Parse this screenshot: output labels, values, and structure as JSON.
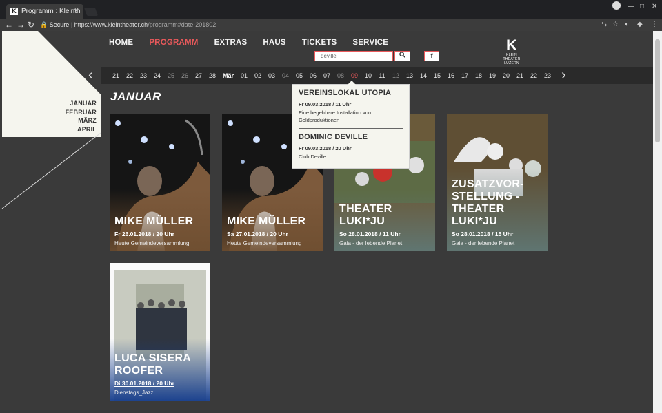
{
  "browser": {
    "tab_title": "Programm : Kleinth",
    "secure_label": "Secure",
    "url_host": "https://www.kleintheater.ch",
    "url_path": "/programm#date-201802"
  },
  "side": {
    "months": [
      "JANUAR",
      "FEBRUAR",
      "MÄRZ",
      "APRIL"
    ]
  },
  "nav": {
    "items": [
      {
        "label": "HOME"
      },
      {
        "label": "PROGRAMM"
      },
      {
        "label": "EXTRAS"
      },
      {
        "label": "HAUS"
      },
      {
        "label": "TICKETS"
      },
      {
        "label": "SERVICE"
      }
    ],
    "active_color": "#e8595b"
  },
  "search": {
    "value": "deville",
    "button_icon": "search-icon",
    "facebook_label": "f"
  },
  "logo": {
    "letter": "K",
    "line1": "KLEIN",
    "line2": "THEATER LUZERN"
  },
  "dates": {
    "feb_days": [
      "21",
      "22",
      "23",
      "24",
      "25",
      "26",
      "27",
      "28"
    ],
    "feb_dim": [
      "25",
      "26"
    ],
    "month_label": "Mär",
    "mar_days": [
      "01",
      "02",
      "03",
      "04",
      "05",
      "06",
      "07",
      "08",
      "09",
      "10",
      "11",
      "12",
      "13",
      "14",
      "15",
      "16",
      "17",
      "18",
      "19",
      "20",
      "21",
      "22",
      "23"
    ],
    "mar_dim": [
      "04",
      "08",
      "12"
    ],
    "mar_hot": [
      "09"
    ]
  },
  "section_title": "JANUAR",
  "cards": [
    {
      "title": "MIKE MÜLLER",
      "date": "Fr 26.01.2018 / 20 Uhr",
      "subtitle": "Heute Gemeindeversammlung"
    },
    {
      "title": "MIKE MÜLLER",
      "date": "Sa 27.01.2018 / 20 Uhr",
      "subtitle": "Heute Gemeindeversammlung"
    },
    {
      "title": "THEATER LUKI*JU",
      "date": "So 28.01.2018 / 11 Uhr",
      "subtitle": "Gaia - der lebende Planet"
    },
    {
      "title": "ZUSATZVOR-STELLUNG - THEATER LUKI*JU",
      "date": "So 28.01.2018 / 15 Uhr",
      "subtitle": "Gaia - der lebende Planet"
    },
    {
      "title": "LUCA SISERA ROOFER",
      "date": "Di 30.01.2018 / 20 Uhr",
      "subtitle": "Dienstags_Jazz"
    }
  ],
  "popup": {
    "events": [
      {
        "title": "VEREINSLOKAL UTOPIA",
        "date": "Fr 09.03.2018 / 11 Uhr",
        "text": "Eine begehbare Installation von Goldproduktionen"
      },
      {
        "title": "DOMINIC DEVILLE",
        "date": "Fr 09.03.2018 / 20 Uhr",
        "text": "Club Deville"
      }
    ]
  }
}
